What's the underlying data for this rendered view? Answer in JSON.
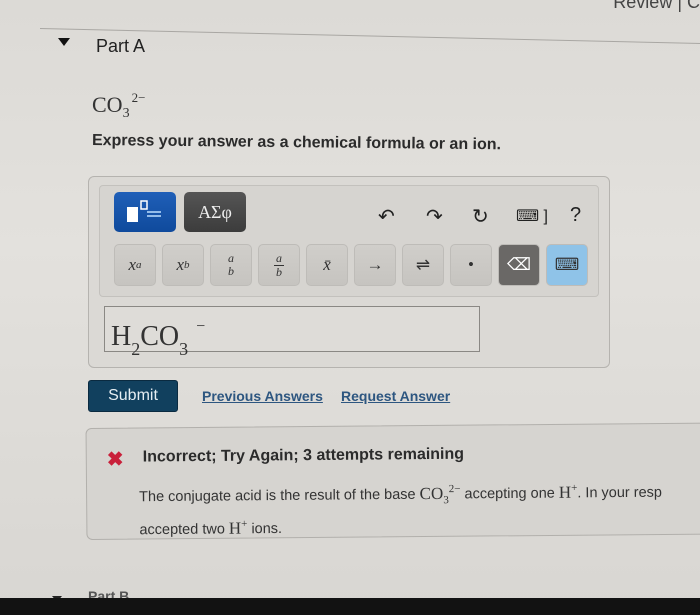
{
  "header": {
    "partial_text": "Review | C"
  },
  "part": {
    "title": "Part A",
    "question_formula": {
      "base": "CO",
      "subscript": "3",
      "charge": "2−"
    },
    "instruction": "Express your answer as a chemical formula or an ion."
  },
  "editor": {
    "mode_buttons": {
      "templates": "templates-mode",
      "greek": "ΑΣφ"
    },
    "actions": {
      "undo": "↶",
      "redo": "↷",
      "reset": "↻",
      "keyboard_shortcuts": "⌨ ]",
      "help": "?"
    },
    "keys": [
      {
        "name": "superscript",
        "label": "x",
        "script": "a"
      },
      {
        "name": "subscript",
        "label": "x",
        "script": "b"
      },
      {
        "name": "stacked",
        "top": "a",
        "bottom": "b"
      },
      {
        "name": "fraction",
        "top": "a",
        "bottom": "b"
      },
      {
        "name": "overline",
        "label": "x̄"
      },
      {
        "name": "reaction-arrow",
        "label": "→"
      },
      {
        "name": "equilibrium-arrow",
        "label": "⇌"
      },
      {
        "name": "dot",
        "label": "•"
      },
      {
        "name": "backspace",
        "label": "⌫"
      },
      {
        "name": "keyboard-toggle",
        "label": "⌨"
      }
    ],
    "answer": {
      "h": "H",
      "h_sub": "2",
      "co": "CO",
      "co_sub": "3",
      "charge": "−"
    }
  },
  "actions": {
    "submit": "Submit",
    "previous_answers": "Previous Answers",
    "request_answer": "Request Answer"
  },
  "feedback": {
    "status": "incorrect",
    "title": "Incorrect; Try Again; 3 attempts remaining",
    "body_1": "The conjugate acid is the result of the base ",
    "formula_base": "CO",
    "formula_sub": "3",
    "formula_charge": "2−",
    "body_2": " accepting one ",
    "h": "H",
    "h_charge": "+",
    "body_3": ". In your resp",
    "body_4": "accepted two ",
    "body_5": " ions.",
    "color": "#c9203a"
  },
  "next_part": {
    "title": "Part B"
  }
}
